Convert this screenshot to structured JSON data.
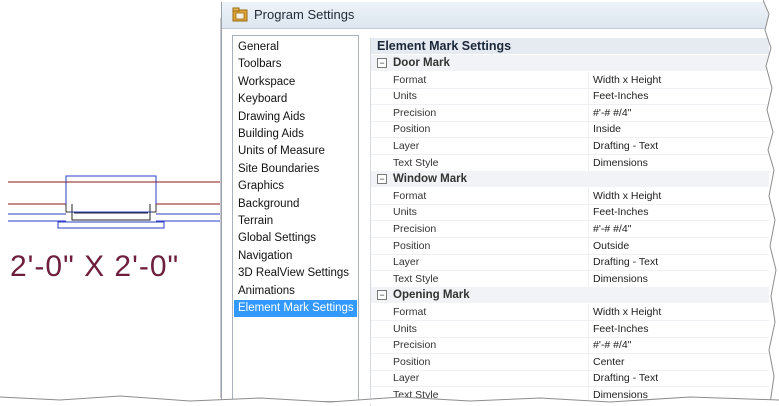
{
  "dialog": {
    "title": "Program Settings",
    "icon": "settings-folder-icon"
  },
  "cad": {
    "dimension_label": "2'-0\" X 2'-0\""
  },
  "nav": {
    "items": [
      {
        "label": "General"
      },
      {
        "label": "Toolbars"
      },
      {
        "label": "Workspace"
      },
      {
        "label": "Keyboard"
      },
      {
        "label": "Drawing Aids"
      },
      {
        "label": "Building Aids"
      },
      {
        "label": "Units of Measure"
      },
      {
        "label": "Site Boundaries"
      },
      {
        "label": "Graphics"
      },
      {
        "label": "Background"
      },
      {
        "label": "Terrain"
      },
      {
        "label": "Global Settings"
      },
      {
        "label": "Navigation"
      },
      {
        "label": "3D RealView Settings"
      },
      {
        "label": "Animations"
      },
      {
        "label": "Element Mark Settings"
      }
    ],
    "selected": "Element Mark Settings"
  },
  "grid": {
    "title": "Element Mark Settings",
    "sections": [
      {
        "name": "Door Mark",
        "toggle": "⊟",
        "rows": [
          {
            "name": "Format",
            "value": "Width x Height"
          },
          {
            "name": "Units",
            "value": "Feet-Inches"
          },
          {
            "name": "Precision",
            "value": "#'-# #/4\""
          },
          {
            "name": "Position",
            "value": "Inside"
          },
          {
            "name": "Layer",
            "value": "Drafting - Text"
          },
          {
            "name": "Text Style",
            "value": "Dimensions"
          }
        ]
      },
      {
        "name": "Window Mark",
        "toggle": "⊟",
        "rows": [
          {
            "name": "Format",
            "value": "Width x Height"
          },
          {
            "name": "Units",
            "value": "Feet-Inches"
          },
          {
            "name": "Precision",
            "value": "#'-# #/4\""
          },
          {
            "name": "Position",
            "value": "Outside"
          },
          {
            "name": "Layer",
            "value": "Drafting - Text"
          },
          {
            "name": "Text Style",
            "value": "Dimensions"
          }
        ]
      },
      {
        "name": "Opening Mark",
        "toggle": "⊟",
        "rows": [
          {
            "name": "Format",
            "value": "Width x Height"
          },
          {
            "name": "Units",
            "value": "Feet-Inches"
          },
          {
            "name": "Precision",
            "value": "#'-# #/4\""
          },
          {
            "name": "Position",
            "value": "Center"
          },
          {
            "name": "Layer",
            "value": "Drafting - Text"
          },
          {
            "name": "Text Style",
            "value": "Dimensions"
          }
        ]
      }
    ]
  },
  "colors": {
    "selection": "#3399ff",
    "dimension_text": "#6e1f3d",
    "wall_red": "#8b1a1a",
    "wall_blue": "#2a3cc8"
  }
}
